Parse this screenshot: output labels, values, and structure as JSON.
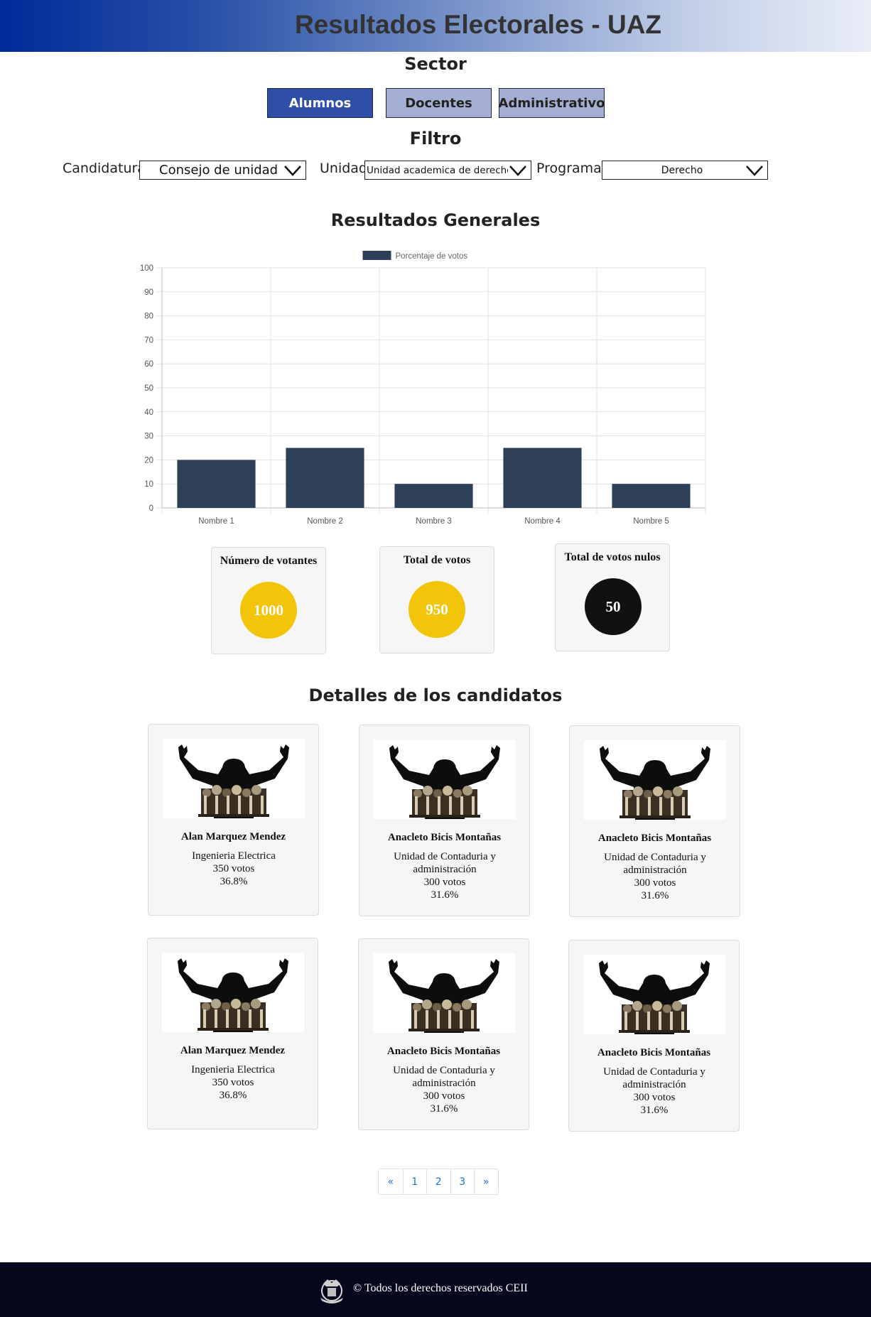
{
  "header": {
    "title": "Resultados Electorales - UAZ"
  },
  "sector": {
    "title": "Sector",
    "buttons": [
      "Alumnos",
      "Docentes",
      "Administrativo"
    ],
    "active": "Alumnos"
  },
  "filter": {
    "title": "Filtro",
    "candidatura": {
      "label": "Candidatura:",
      "value": "Consejo de unidad"
    },
    "unidad": {
      "label": "Unidad:",
      "value": "Unidad academica de derecho"
    },
    "programa": {
      "label": "Programa:",
      "value": "Derecho"
    }
  },
  "results": {
    "title": "Resultados Generales"
  },
  "chart_data": {
    "type": "bar",
    "categories": [
      "Nombre 1",
      "Nombre 2",
      "Nombre 3",
      "Nombre 4",
      "Nombre 5"
    ],
    "series": [
      {
        "name": "Porcentaje de votos",
        "values": [
          20,
          25,
          10,
          25,
          10
        ],
        "color": "#2e4057"
      }
    ],
    "ylim": [
      0,
      100
    ],
    "yticks": [
      0,
      10,
      20,
      30,
      40,
      50,
      60,
      70,
      80,
      90,
      100
    ],
    "grid": true,
    "legend": "top-center"
  },
  "stats": {
    "voters": {
      "title": "Número de votantes",
      "value": "1000",
      "color": "#f2c40a"
    },
    "votes": {
      "title": "Total de votos",
      "value": "950",
      "color": "#f2c40a"
    },
    "null_votes": {
      "title": "Total de votos nulos",
      "value": "50",
      "color": "#111111"
    }
  },
  "candidates": {
    "title": "Detalles de los candidatos",
    "items": [
      {
        "name": "Alan Marquez Mendez",
        "program": "Ingenieria Electrica",
        "votes": "350 votos",
        "percent": "36.8%"
      },
      {
        "name": "Anacleto Bicis Montañas",
        "program": "Unidad de Contaduria y administración",
        "votes": "300 votos",
        "percent": "31.6%"
      },
      {
        "name": "Anacleto Bicis Montañas",
        "program": "Unidad de Contaduria y administración",
        "votes": "300 votos",
        "percent": "31.6%"
      },
      {
        "name": "Alan Marquez Mendez",
        "program": "Ingenieria Electrica",
        "votes": "350 votos",
        "percent": "36.8%"
      },
      {
        "name": "Anacleto Bicis Montañas",
        "program": "Unidad de Contaduria y administración",
        "votes": "300 votos",
        "percent": "31.6%"
      },
      {
        "name": "Anacleto Bicis Montañas",
        "program": "Unidad de Contaduria y administración",
        "votes": "300 votos",
        "percent": "31.6%"
      }
    ]
  },
  "pagination": {
    "prev": "«",
    "pages": [
      "1",
      "2",
      "3"
    ],
    "next": "»"
  },
  "footer": {
    "text": "© Todos los derechos reservados CEII"
  }
}
